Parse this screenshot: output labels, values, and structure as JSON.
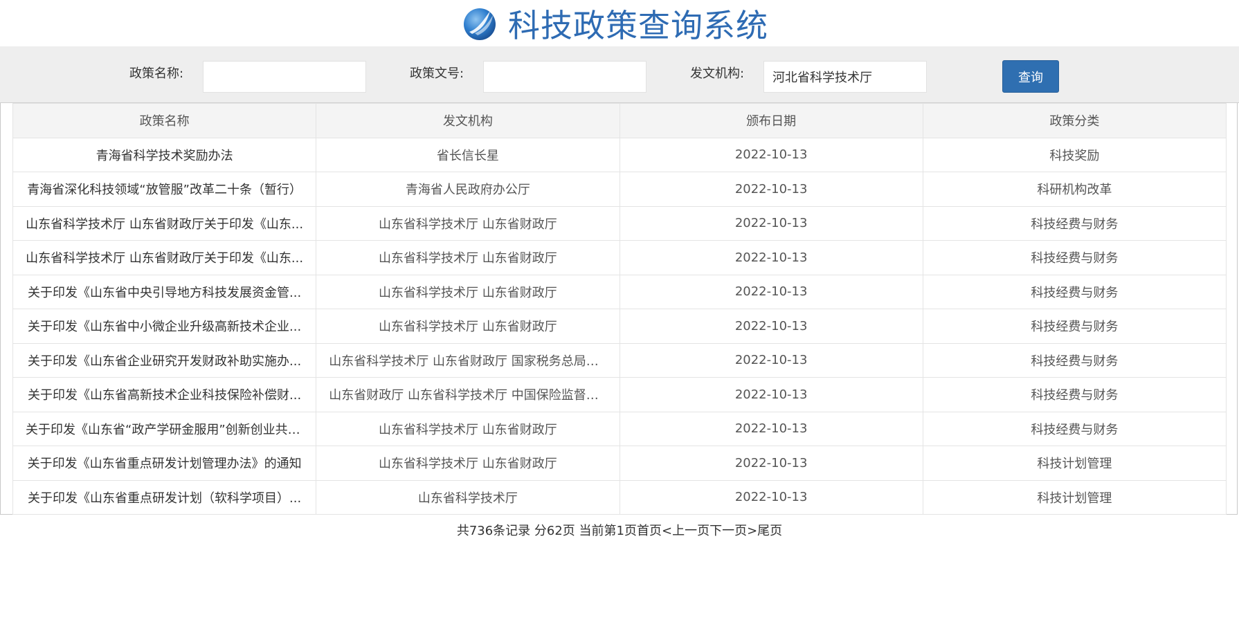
{
  "app": {
    "title": "科技政策查询系统"
  },
  "search": {
    "policy_name_label": "政策名称:",
    "policy_name_value": "",
    "policy_number_label": "政策文号:",
    "policy_number_value": "",
    "issuer_label": "发文机构:",
    "issuer_value": "河北省科学技术厅",
    "query_button": "查询"
  },
  "table": {
    "columns": [
      "政策名称",
      "发文机构",
      "颁布日期",
      "政策分类"
    ],
    "rows": [
      [
        "青海省科学技术奖励办法",
        "省长信长星",
        "2022-10-13",
        "科技奖励"
      ],
      [
        "青海省深化科技领域“放管服”改革二十条（暂行）",
        "青海省人民政府办公厅",
        "2022-10-13",
        "科研机构改革"
      ],
      [
        "山东省科学技术厅 山东省财政厅关于印发《山东...",
        "山东省科学技术厅 山东省财政厅",
        "2022-10-13",
        "科技经费与财务"
      ],
      [
        "山东省科学技术厅 山东省财政厅关于印发《山东...",
        "山东省科学技术厅 山东省财政厅",
        "2022-10-13",
        "科技经费与财务"
      ],
      [
        "关于印发《山东省中央引导地方科技发展资金管...",
        "山东省科学技术厅 山东省财政厅",
        "2022-10-13",
        "科技经费与财务"
      ],
      [
        "关于印发《山东省中小微企业升级高新技术企业...",
        "山东省科学技术厅 山东省财政厅",
        "2022-10-13",
        "科技经费与财务"
      ],
      [
        "关于印发《山东省企业研究开发财政补助实施办...",
        "山东省科学技术厅 山东省财政厅 国家税务总局山...",
        "2022-10-13",
        "科技经费与财务"
      ],
      [
        "关于印发《山东省高新技术企业科技保险补偿财...",
        "山东省财政厅 山东省科学技术厅 中国保险监督管...",
        "2022-10-13",
        "科技经费与财务"
      ],
      [
        "关于印发《山东省“政产学研金服用”创新创业共同...",
        "山东省科学技术厅 山东省财政厅",
        "2022-10-13",
        "科技经费与财务"
      ],
      [
        "关于印发《山东省重点研发计划管理办法》的通知",
        "山东省科学技术厅 山东省财政厅",
        "2022-10-13",
        "科技计划管理"
      ],
      [
        "关于印发《山东省重点研发计划（软科学项目）...",
        "山东省科学技术厅",
        "2022-10-13",
        "科技计划管理"
      ]
    ]
  },
  "pagination": {
    "summary": "共736条记录 分62页 当前第1页",
    "first": "首页",
    "prev": "<上一页",
    "next": "下一页>",
    "last": "尾页"
  },
  "colors": {
    "title": "#2e6bb3",
    "button": "#2f6fb1",
    "search_bar": "#eeeeee"
  },
  "icons": {
    "logo": "blue-sphere-leaf-logo"
  }
}
